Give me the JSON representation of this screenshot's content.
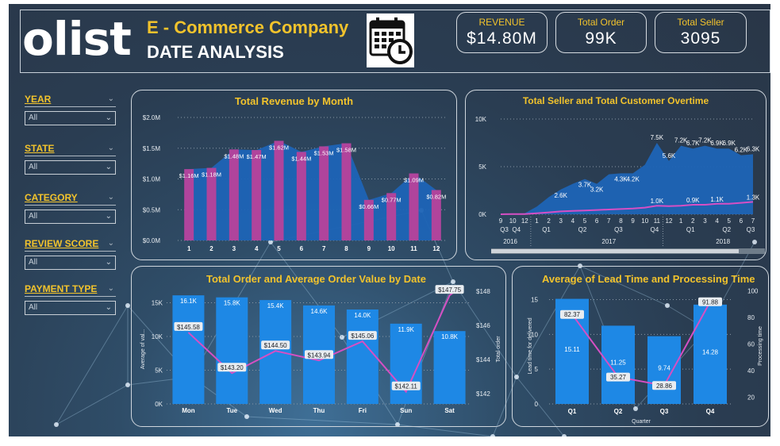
{
  "header": {
    "logo": "olist",
    "title": "E - Commerce Company",
    "subtitle": "DATE ANALYSIS",
    "calendar_icon": "calendar-clock-icon"
  },
  "kpis": [
    {
      "label": "REVENUE",
      "value": "$14.80M"
    },
    {
      "label": "Total Order",
      "value": "99K"
    },
    {
      "label": "Total Seller",
      "value": "3095"
    }
  ],
  "filters": [
    {
      "label": "YEAR",
      "value": "All"
    },
    {
      "label": "STATE",
      "value": "All"
    },
    {
      "label": "CATEGORY",
      "value": "All"
    },
    {
      "label": "REVIEW SCORE",
      "value": "All"
    },
    {
      "label": "PAYMENT TYPE",
      "value": "All"
    }
  ],
  "colors": {
    "accent": "#f2c32c",
    "bar_blue": "#1e88e5",
    "bar_magenta": "#b0449c",
    "line_pink": "#d64fc4",
    "area_blue": "#1d64b6"
  },
  "chart_data": [
    {
      "type": "bar",
      "title": "Total Revenue by Month",
      "categories": [
        "1",
        "2",
        "3",
        "4",
        "5",
        "6",
        "7",
        "8",
        "9",
        "10",
        "11",
        "12"
      ],
      "series": [
        {
          "values": [
            1.16,
            1.18,
            1.48,
            1.47,
            1.62,
            1.44,
            1.53,
            1.58,
            0.66,
            0.77,
            1.09,
            0.82
          ]
        }
      ],
      "data_labels": [
        "$1.16M",
        "$1.18M",
        "$1.48M",
        "$1.47M",
        "$1.62M",
        "$1.44M",
        "$1.53M",
        "$1.58M",
        "$0.66M",
        "$0.77M",
        "$1.09M",
        "$0.82M"
      ],
      "y_ticks": [
        "$0.0M",
        "$0.5M",
        "$1.0M",
        "$1.5M",
        "$2.0M"
      ],
      "ylim": [
        0,
        2.0
      ],
      "grid": true
    },
    {
      "type": "area",
      "title": "Total Seller and Total Customer Overtime",
      "x_months": [
        "9",
        "10",
        "12",
        "1",
        "2",
        "3",
        "4",
        "5",
        "6",
        "7",
        "8",
        "9",
        "10",
        "11",
        "12",
        "1",
        "2",
        "3",
        "4",
        "5",
        "6",
        "7"
      ],
      "x_quarters": [
        "Q3",
        "Q4",
        "Q1",
        "Q2",
        "Q3",
        "Q4",
        "Q1",
        "Q2",
        "Q3"
      ],
      "x_years": [
        "2016",
        "2017",
        "2018"
      ],
      "series": [
        {
          "values": [
            0,
            0.05,
            0.1,
            0.8,
            1.8,
            2.6,
            3.2,
            3.7,
            3.2,
            4.2,
            4.3,
            4.3,
            5.2,
            7.5,
            5.6,
            7.2,
            6.9,
            7.2,
            6.9,
            6.9,
            6.2,
            6.3
          ]
        },
        {
          "values": [
            0,
            0.02,
            0.02,
            0.1,
            0.2,
            0.3,
            0.35,
            0.4,
            0.45,
            0.5,
            0.55,
            0.6,
            0.7,
            0.9,
            0.85,
            0.9,
            1.0,
            1.0,
            1.1,
            1.1,
            1.2,
            1.3
          ]
        }
      ],
      "value_labels": [
        {
          "i": 5,
          "text": "2.6K"
        },
        {
          "i": 7,
          "text": "3.7K"
        },
        {
          "i": 8,
          "text": "3.2K"
        },
        {
          "i": 10,
          "text": "4.3K"
        },
        {
          "i": 11,
          "text": "4.2K"
        },
        {
          "i": 13,
          "text": "7.5K"
        },
        {
          "i": 14,
          "text": "5.6K"
        },
        {
          "i": 15,
          "text": "7.2K"
        },
        {
          "i": 16,
          "text": "6.7K"
        },
        {
          "i": 17,
          "text": "7.2K"
        },
        {
          "i": 18,
          "text": "6.9K"
        },
        {
          "i": 19,
          "text": "6.9K"
        },
        {
          "i": 20,
          "text": "6.2K"
        },
        {
          "i": 21,
          "text": "6.3K"
        }
      ],
      "lower_labels": [
        {
          "i": 13,
          "text": "1.0K"
        },
        {
          "i": 16,
          "text": "0.9K"
        },
        {
          "i": 18,
          "text": "1.1K"
        },
        {
          "i": 21,
          "text": "1.3K"
        }
      ],
      "y_ticks": [
        "0K",
        "5K",
        "10K"
      ],
      "ylim": [
        0,
        10
      ]
    },
    {
      "type": "bar",
      "title": "Total Order and Average Order Value by Date",
      "categories": [
        "Mon",
        "Tue",
        "Wed",
        "Thu",
        "Fri",
        "Sun",
        "Sat"
      ],
      "series": [
        {
          "values": [
            16.1,
            15.8,
            15.4,
            14.6,
            14.0,
            11.9,
            10.8
          ]
        },
        {
          "values": [
            145.58,
            143.2,
            144.5,
            143.94,
            145.06,
            142.11,
            147.75
          ]
        }
      ],
      "bar_labels": [
        "16.1K",
        "15.8K",
        "15.4K",
        "14.6K",
        "14.0K",
        "11.9K",
        "10.8K"
      ],
      "line_labels": [
        "$145.58",
        "$143.20",
        "$144.50",
        "$143.94",
        "$145.06",
        "$142.11",
        "$147.75"
      ],
      "ylabel": "Average of val...",
      "y2label": "Total order",
      "y_ticks": [
        "0K",
        "5K",
        "10K",
        "15K"
      ],
      "y2_ticks": [
        "$142",
        "$144",
        "$146",
        "$148"
      ],
      "ylim": [
        0,
        18
      ],
      "y2lim": [
        141.4,
        148.5
      ]
    },
    {
      "type": "bar",
      "title": "Average of Lead Time and Processing Time",
      "categories": [
        "Q1",
        "Q2",
        "Q3",
        "Q4"
      ],
      "series": [
        {
          "values": [
            15.11,
            11.25,
            9.74,
            14.28
          ]
        },
        {
          "values": [
            82.37,
            35.27,
            28.86,
            91.88
          ]
        }
      ],
      "bar_labels": [
        "15.11",
        "11.25",
        "9.74",
        "14.28"
      ],
      "line_labels": [
        "82.37",
        "35.27",
        "28.86",
        "91.88"
      ],
      "xlabel": "Quarter",
      "ylabel": "Lead time for delivered",
      "y2label": "Processing time",
      "y_ticks": [
        "0",
        "5",
        "10",
        "15"
      ],
      "y2_ticks": [
        "20",
        "40",
        "60",
        "80",
        "100"
      ],
      "ylim": [
        0,
        17
      ],
      "y2lim": [
        15,
        104
      ]
    }
  ]
}
